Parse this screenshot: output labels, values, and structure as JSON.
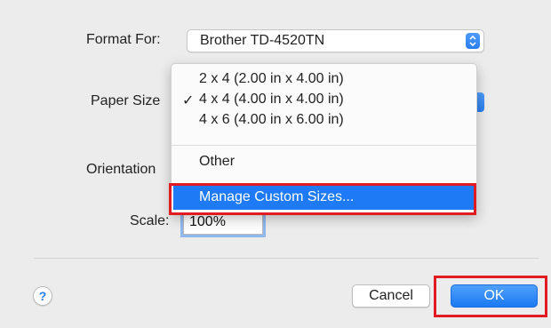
{
  "form": {
    "format_for_label": "Format For:",
    "format_for_value": "Brother TD-4520TN",
    "paper_size_label": "Paper Size",
    "orientation_label": "Orientation",
    "scale_label": "Scale:",
    "scale_value": "100%"
  },
  "paper_menu": {
    "items": [
      {
        "label": "2 x 4 (2.00 in x 4.00 in)",
        "checked": false
      },
      {
        "label": "4 x 4 (4.00 in x 4.00 in)",
        "checked": true
      },
      {
        "label": "4 x 6 (4.00 in x 6.00 in)",
        "checked": false
      },
      {
        "label": "Other",
        "checked": false
      },
      {
        "label": "Manage Custom Sizes...",
        "checked": false,
        "highlighted": true
      }
    ],
    "check_mark": "✓"
  },
  "footer": {
    "help_symbol": "?",
    "cancel_label": "Cancel",
    "ok_label": "OK"
  },
  "colors": {
    "accent": "#1e7bf5",
    "annotation_red": "#e01b22",
    "background": "#ececec"
  }
}
